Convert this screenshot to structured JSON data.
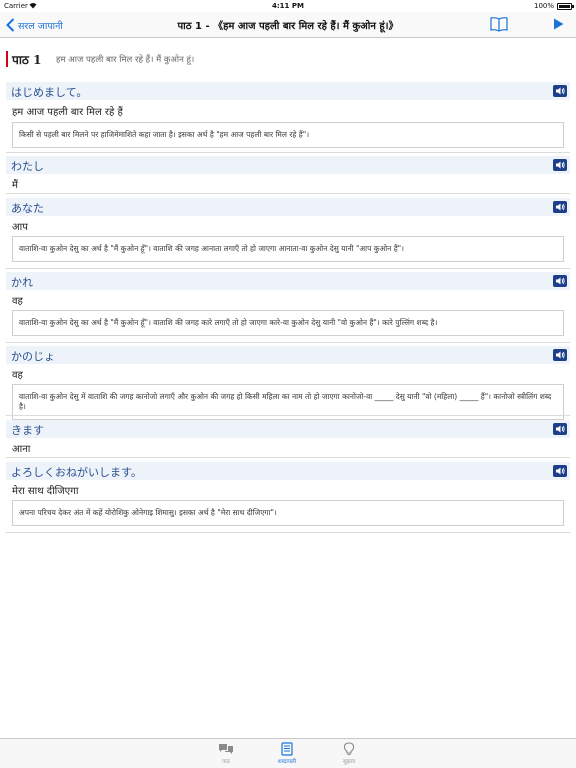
{
  "status": {
    "carrier": "Carrier",
    "time": "4:11 PM",
    "battery": "100%"
  },
  "nav": {
    "back_label": "सरल जापानी",
    "title": "पाठ 1 - 《हम आज पहली बार मिल रहे हैं। मैं कुओन हूं।》",
    "book_icon": "book-icon",
    "play_icon": "play-icon"
  },
  "lesson": {
    "number": "पाठ 1",
    "subtitle": "हम आज पहली बार मिल रहे हैं। मैं कुओन हूं।"
  },
  "entries": [
    {
      "japanese": "はじめまして。",
      "meaning": "हम आज पहली बार मिल रहे हैं",
      "note": "किसी से पहली बार मिलने पर हाजिमेमाशिते कहा जाता है। इसका अर्थ है \"हम आज पहली बार मिल रहे हैं\"।"
    },
    {
      "japanese": "わたし",
      "meaning": "मैं",
      "note": ""
    },
    {
      "japanese": "あなた",
      "meaning": "आप",
      "note": "वाताशि-वा कुओन देसु का अर्थ है \"मैं कुओन हूँ\"। वाताशि की जगह आनाता लगाएँ तो हो जाएगा आनाता-वा कुओन देसु यानी \"आप कुओन हैं\"।"
    },
    {
      "japanese": "かれ",
      "meaning": "वह",
      "note": "वाताशि-वा कुओन देसु का अर्थ है \"मैं कुओन हूँ\"। वाताशि की जगह कारे लगाएँ तो हो जाएगा कारे-वा कुओन देसु यानी \"वो कुओन हैं\"। कारे पुल्लिंग शब्द है।"
    },
    {
      "japanese": "かのじょ",
      "meaning": "वह",
      "note": "वाताशि-वा कुओन देसु में वाताशि की जगह कानोजो लगाएँ और कुओन की जगह हो किसी महिला का नाम तो हो जाएगा कानोजो-वा _____ देसु यानी \"वो (महिला) _____ हैं\"। कानोजो स्त्रीलिंग शब्द है।"
    },
    {
      "japanese": "きます",
      "meaning": "आना",
      "note": ""
    },
    {
      "japanese": "よろしくおねがいします。",
      "meaning": "मेरा साथ दीजिएगा",
      "note": "अपना परिचय देकर अंत में कहें योरोशिकु ओनेगाइ शिमासु। इसका अर्थ है \"मेरा साथ दीजिएगा\"।"
    }
  ],
  "tabs": [
    {
      "label": "पाठ",
      "icon": "chat-bubbles-icon",
      "active": false
    },
    {
      "label": "शब्दावली",
      "icon": "vocabulary-book-icon",
      "active": true
    },
    {
      "label": "सुझाव",
      "icon": "lightbulb-icon",
      "active": false
    }
  ],
  "colors": {
    "accent": "#1a73d9",
    "lesson_bar": "#d0021b",
    "entry_header_bg": "#eef3f9",
    "japanese_text": "#2a4f8f",
    "speaker_bg": "#1d3f8a"
  }
}
